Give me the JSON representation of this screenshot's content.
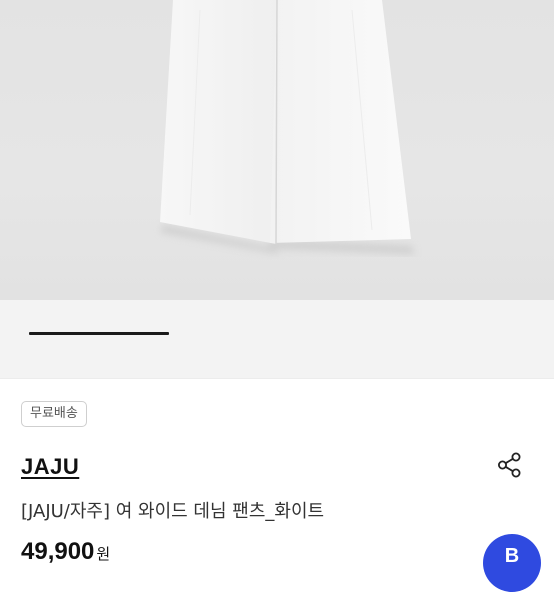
{
  "product": {
    "badge": "무료배송",
    "brand": "JAJU",
    "title": "[JAJU/자주] 여 와이드 데님 팬츠_화이트",
    "price": "49,900",
    "price_unit": "원"
  },
  "gallery": {
    "background_color": "#e4e4e4",
    "product_color": "#f4f4f4"
  },
  "icons": {
    "share": "share-icon"
  },
  "fab": {
    "label": "B",
    "color": "#2f4ae0"
  }
}
